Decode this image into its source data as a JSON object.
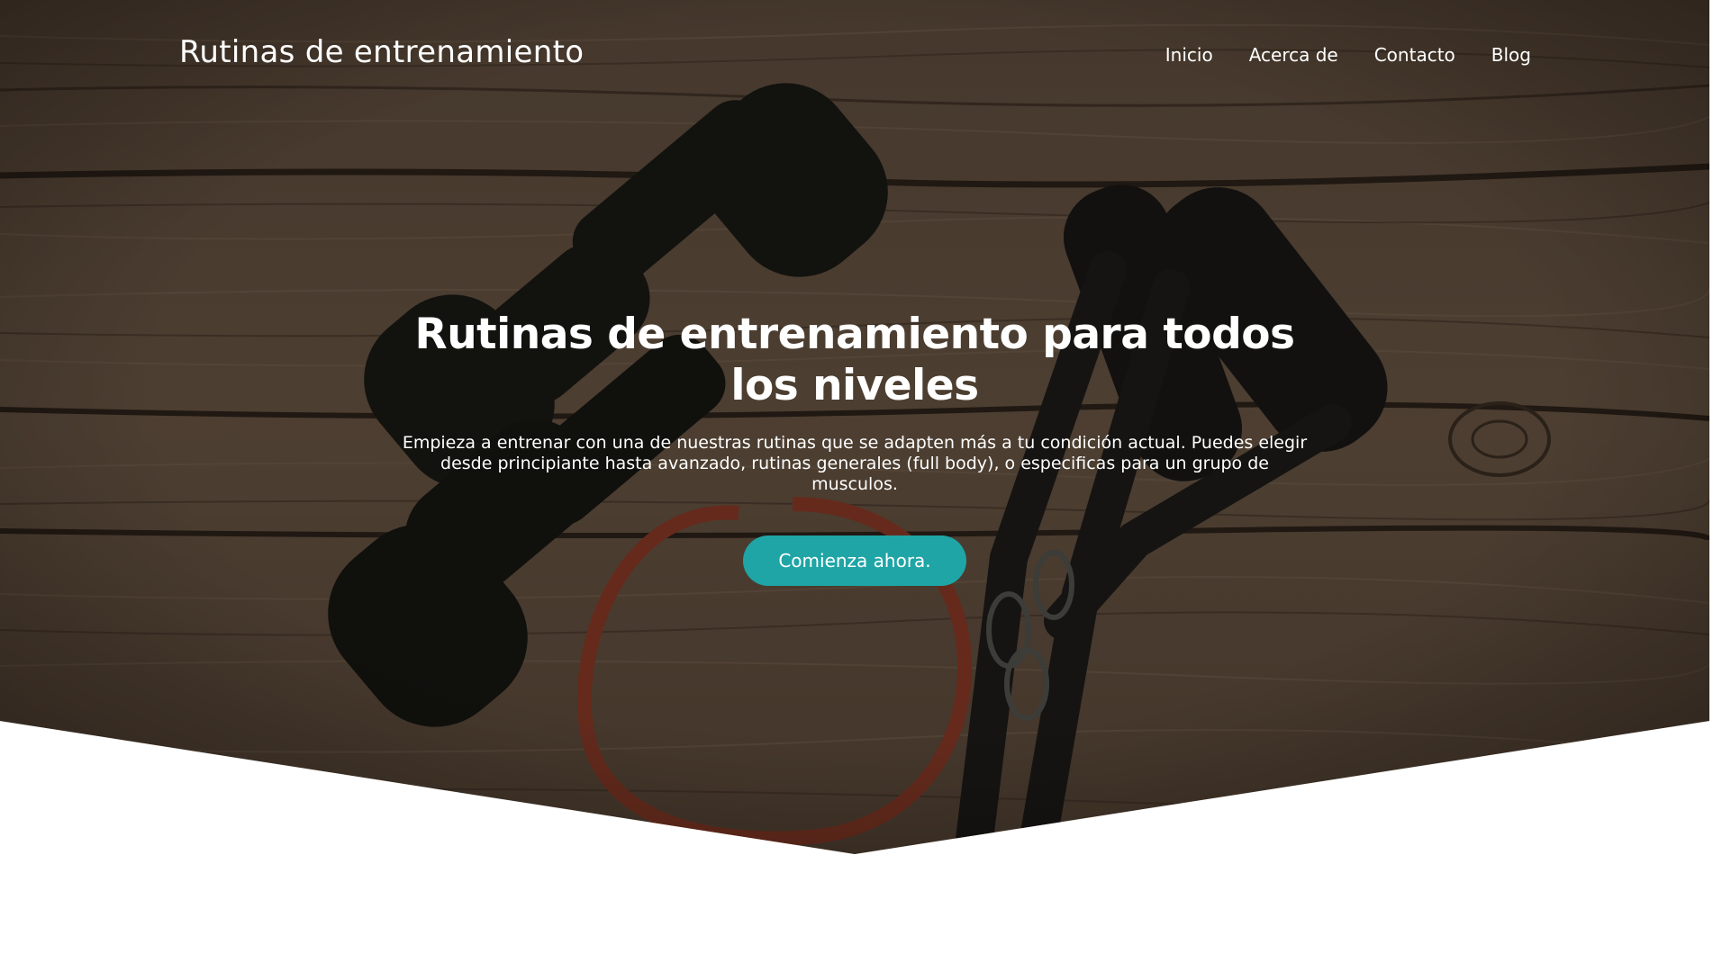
{
  "brand": {
    "title": "Rutinas de entrenamiento"
  },
  "nav": {
    "items": [
      {
        "label": "Inicio"
      },
      {
        "label": "Acerca de"
      },
      {
        "label": "Contacto"
      },
      {
        "label": "Blog"
      }
    ]
  },
  "hero": {
    "title": "Rutinas de entrenamiento para todos los niveles",
    "text": "Empieza a entrenar con una de nuestras rutinas que se adapten más a tu condición actual. Puedes elegir desde principiante hasta avanzado, rutinas generales (full body), o especificas para un grupo de musculos.",
    "cta_label": "Comienza ahora.",
    "background_image": "dumbbells-resistance-band-wood-photo"
  },
  "colors": {
    "accent": "#1fa5a6",
    "text_on_hero": "#ffffff",
    "page_background": "#ffffff"
  }
}
